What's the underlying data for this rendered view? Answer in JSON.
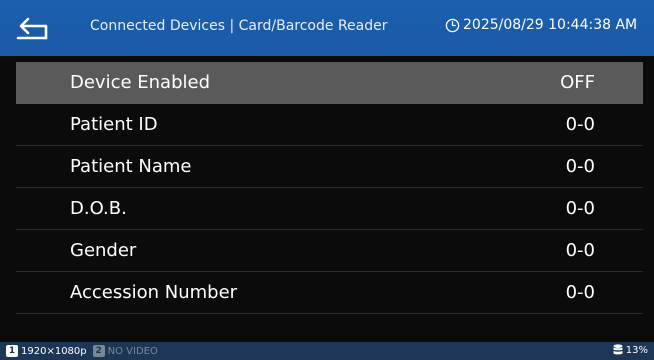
{
  "header": {
    "title": "Connected Devices | Card/Barcode Reader",
    "datetime": "2025/08/29 10:44:38 AM",
    "back_icon": "back-arrow-icon",
    "clock_icon": "clock-icon"
  },
  "rows": [
    {
      "label": "Device Enabled",
      "value": "OFF"
    },
    {
      "label": "Patient ID",
      "value": "0-0"
    },
    {
      "label": "Patient Name",
      "value": "0-0"
    },
    {
      "label": "D.O.B.",
      "value": "0-0"
    },
    {
      "label": "Gender",
      "value": "0-0"
    },
    {
      "label": "Accession Number",
      "value": "0-0"
    }
  ],
  "status_bar": {
    "channel1_number": "1",
    "channel1_text": "1920×1080p",
    "channel2_number": "2",
    "channel2_text": "NO VIDEO",
    "storage": "13%"
  },
  "colors": {
    "header": "#1b5fae",
    "selected_row": "#5a5a5a",
    "status_bar": "#1d3655"
  }
}
